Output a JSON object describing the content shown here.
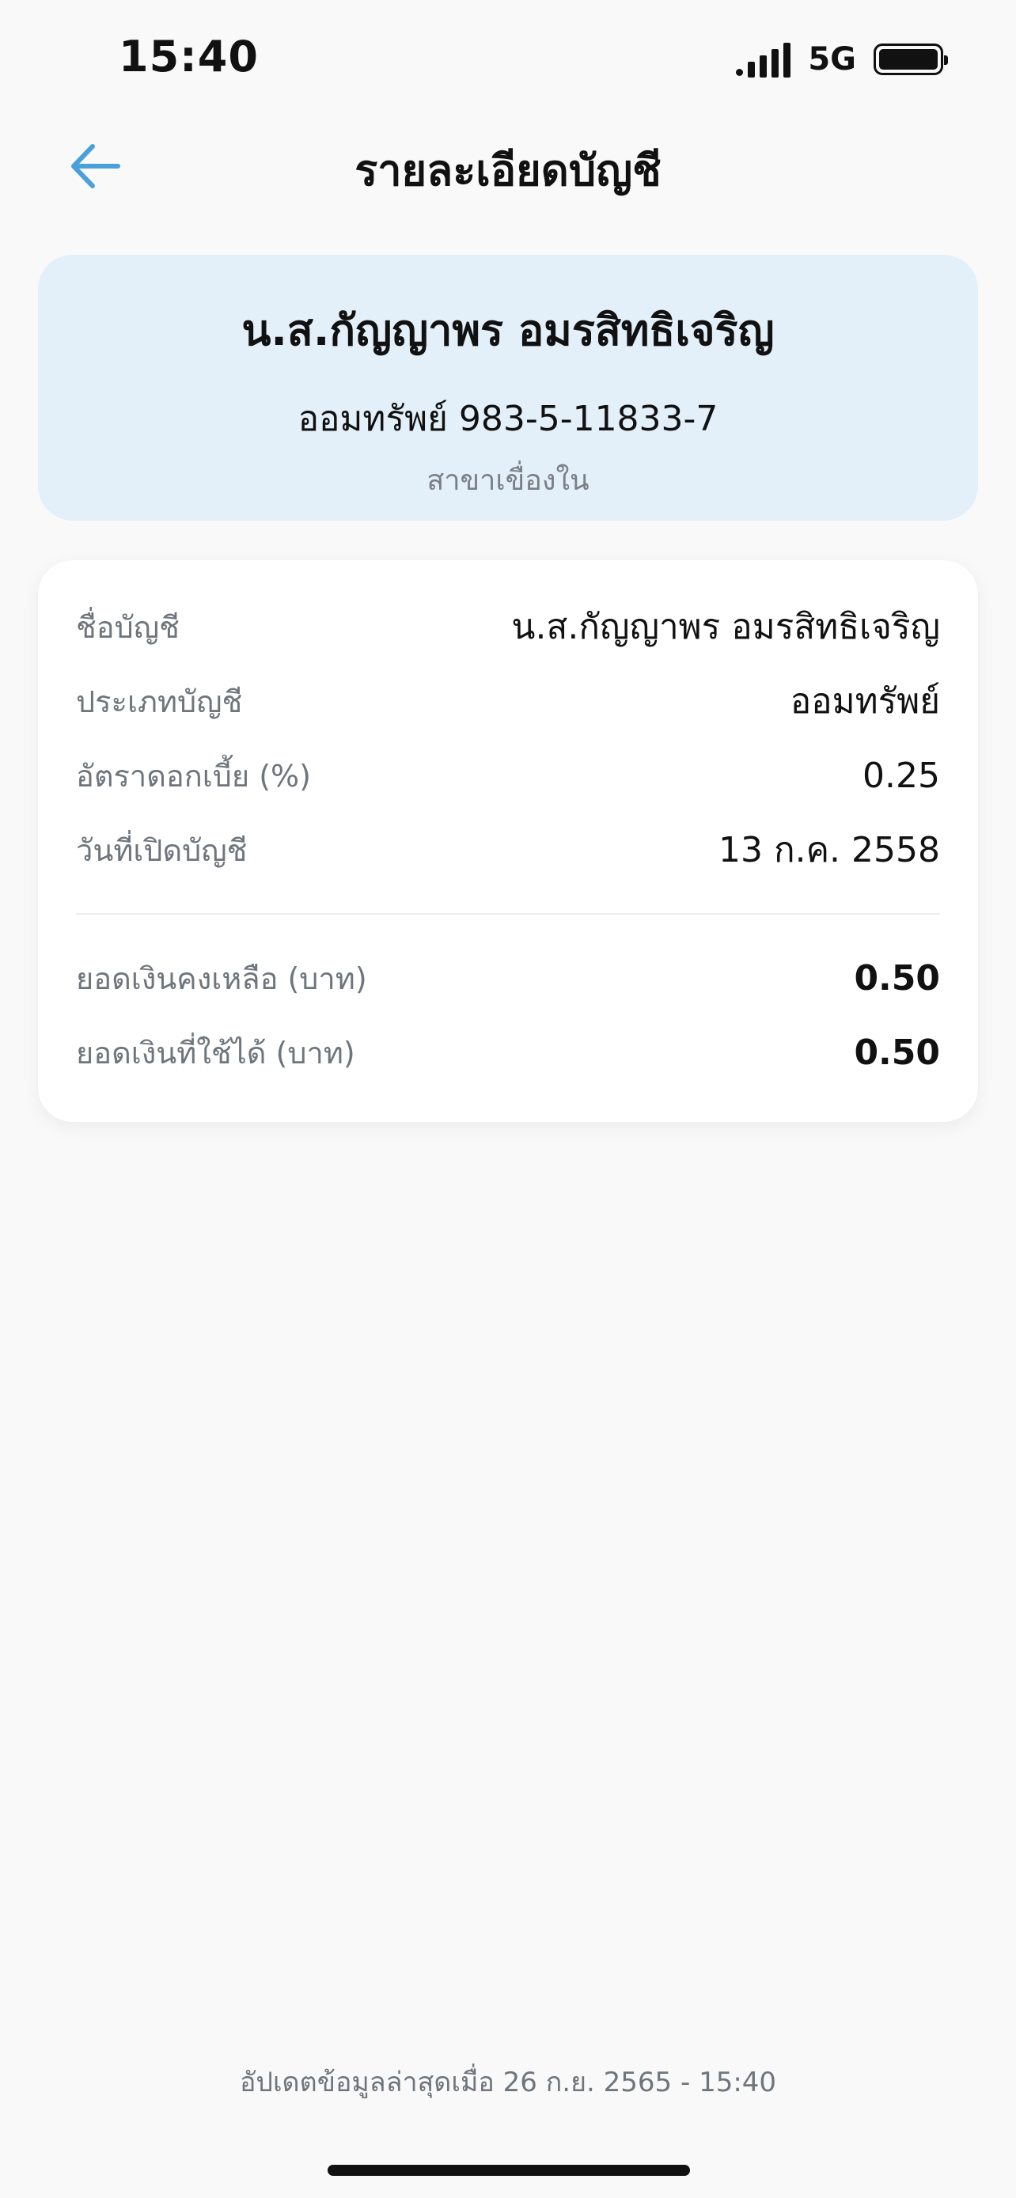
{
  "status_bar": {
    "time": "15:40",
    "network": "5G",
    "signal_icon": "signal-bars-icon",
    "battery_icon": "battery-icon"
  },
  "header": {
    "title": "รายละเอียดบัญชี",
    "back_icon": "arrow-left-icon",
    "accent_color": "#4aa0db"
  },
  "summary": {
    "name": "น.ส.กัญญาพร อมรสิทธิเจริญ",
    "account": "ออมทรัพย์ 983-5-11833-7",
    "branch": "สาขาเขื่องใน"
  },
  "details": {
    "rows": [
      {
        "label": "ชื่อบัญชี",
        "value": "น.ส.กัญญาพร อมรสิทธิเจริญ"
      },
      {
        "label": "ประเภทบัญชี",
        "value": "ออมทรัพย์"
      },
      {
        "label": "อัตราดอกเบี้ย (%)",
        "value": "0.25"
      },
      {
        "label": "วันที่เปิดบัญชี",
        "value": "13 ก.ค. 2558"
      }
    ],
    "balances": [
      {
        "label": "ยอดเงินคงเหลือ (บาท)",
        "value": "0.50"
      },
      {
        "label": "ยอดเงินที่ใช้ได้ (บาท)",
        "value": "0.50"
      }
    ]
  },
  "footer": {
    "updated": "อัปเดตข้อมูลล่าสุดเมื่อ 26 ก.ย. 2565 - 15:40"
  }
}
